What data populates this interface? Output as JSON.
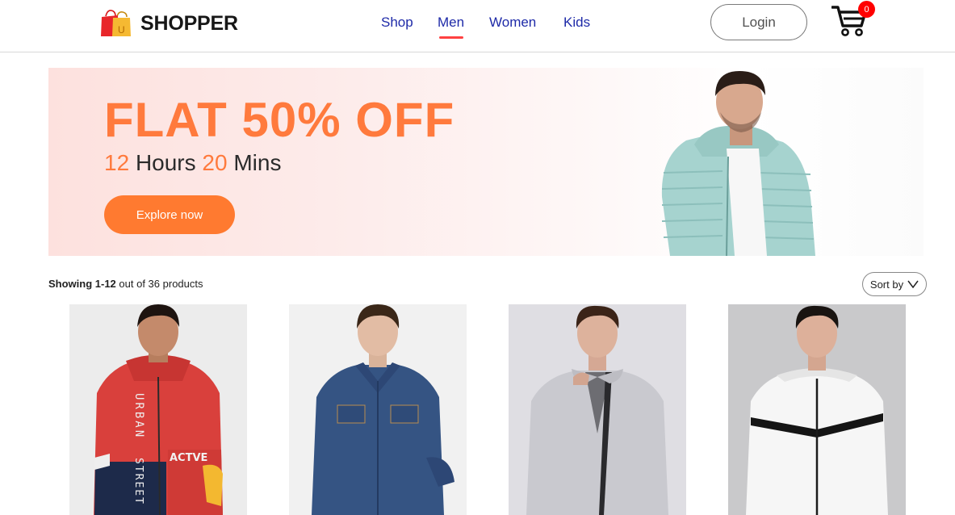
{
  "header": {
    "brand": "SHOPPER",
    "logo_letter": "U",
    "nav": [
      {
        "label": "Shop",
        "active": false
      },
      {
        "label": "Men",
        "active": true
      },
      {
        "label": "Women",
        "active": false
      },
      {
        "label": "Kids",
        "active": false
      }
    ],
    "login_label": "Login",
    "cart_count": "0"
  },
  "hero": {
    "title": "FLAT 50% OFF",
    "hours_value": "12",
    "hours_label": "Hours",
    "mins_value": "20",
    "mins_label": "Mins",
    "cta_label": "Explore now"
  },
  "listing": {
    "showing_range": "Showing 1-12",
    "showing_rest": "out of 36 products",
    "sort_label": "Sort by"
  },
  "products": [
    {
      "item": "red-navy-hooded-jacket",
      "print_1": "URBAN",
      "print_2": "STREET",
      "print_3": "ACTVE"
    },
    {
      "item": "denim-jacket"
    },
    {
      "item": "grey-zip-jacket"
    },
    {
      "item": "white-hooded-windcheater"
    }
  ],
  "colors": {
    "accent": "#ff7a3d",
    "nav_link": "#1e2aa8",
    "active_underline": "#ff4141",
    "badge": "#ff0000"
  }
}
